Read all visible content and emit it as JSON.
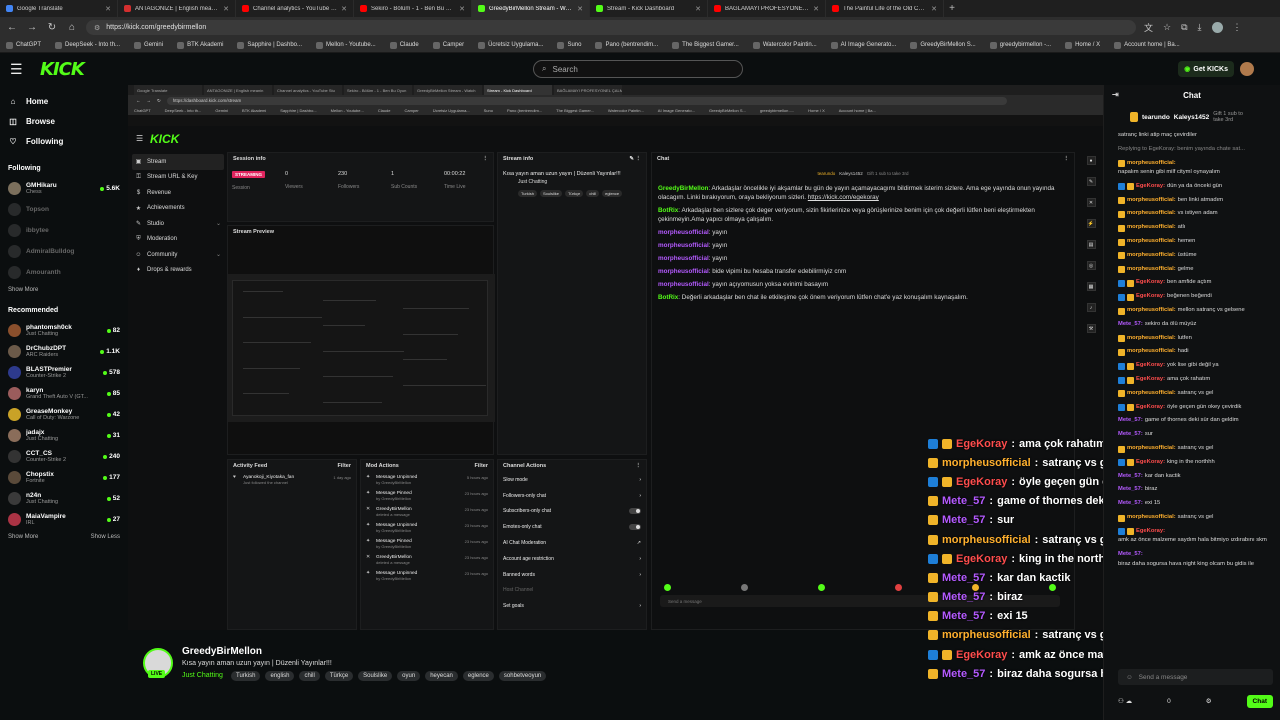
{
  "browser": {
    "tabs": [
      {
        "title": "Google Translate",
        "color": "#4285f4",
        "active": false
      },
      {
        "title": "ANTAGONIZE | English meaning -",
        "color": "#d32f2f",
        "active": false
      },
      {
        "title": "Channel analytics - YouTube Studi",
        "color": "#ff0000",
        "active": false
      },
      {
        "title": "Sekiro - Bölüm - 1 - Ben Bu Oyunu",
        "color": "#ff0000",
        "active": false
      },
      {
        "title": "GreedyBirMellon Stream - Watch",
        "color": "#53fc18",
        "active": true
      },
      {
        "title": "Stream - Kick Dashboard",
        "color": "#53fc18",
        "active": false
      },
      {
        "title": "BAĞLAMAYI PROFESYONEL ÇALM",
        "color": "#ff0000",
        "active": false
      },
      {
        "title": "The Painful Life of the Old Couple",
        "color": "#ff0000",
        "active": false
      }
    ],
    "new_tab": "+",
    "url": "https://kick.com/greedybirmellon",
    "bookmarks": [
      "ChatGPT",
      "DeepSeek - Into th...",
      "Gemini",
      "BTK Akademi",
      "Sapphire | Dashbo...",
      "Mellon - Youtube...",
      "Claude",
      "Camper",
      "Ücretsiz Uygulama...",
      "Suno",
      "Pano (bentrendim...",
      "The Biggest Gamer...",
      "Watercolor Paintin...",
      "AI Image Generato...",
      "GreedyBirMellon S...",
      "greedybirmellon -...",
      "Home / X",
      "Account home | Ba..."
    ]
  },
  "header": {
    "logo": "KICK",
    "search_placeholder": "Search",
    "get_kicks": "Get KICKs"
  },
  "sidebar": {
    "nav": [
      {
        "label": "Home",
        "icon": "⌂"
      },
      {
        "label": "Browse",
        "icon": "◫"
      },
      {
        "label": "Following",
        "icon": "♡"
      }
    ],
    "following_title": "Following",
    "following": [
      {
        "name": "GMHikaru",
        "category": "Chess",
        "viewers": "5.6K",
        "online": true,
        "color": "#7b6f5c"
      },
      {
        "name": "Topson",
        "category": "",
        "viewers": "",
        "online": false,
        "color": "#555"
      },
      {
        "name": "ibbytee",
        "category": "",
        "viewers": "",
        "online": false,
        "color": "#555"
      },
      {
        "name": "AdmiralBulldog",
        "category": "",
        "viewers": "",
        "online": false,
        "color": "#555"
      },
      {
        "name": "Amouranth",
        "category": "",
        "viewers": "",
        "online": false,
        "color": "#555"
      }
    ],
    "show_more_1": "Show More",
    "recommended_title": "Recommended",
    "recommended": [
      {
        "name": "phantomsh0ck",
        "category": "Just Chatting",
        "viewers": "82",
        "color": "#8a4f2c"
      },
      {
        "name": "DrChubzDPT",
        "category": "ARC Raiders",
        "viewers": "1.1K",
        "color": "#6b5a49"
      },
      {
        "name": "BLASTPremier",
        "category": "Counter-Strike 2",
        "viewers": "578",
        "color": "#2d3a8c"
      },
      {
        "name": "karyn",
        "category": "Grand Theft Auto V (GT...",
        "viewers": "85",
        "color": "#9b5c5c"
      },
      {
        "name": "GreaseMonkey",
        "category": "Call of Duty: Warzone",
        "viewers": "42",
        "color": "#c9a227"
      },
      {
        "name": "jadajx",
        "category": "Just Chatting",
        "viewers": "31",
        "color": "#8a6d5a"
      },
      {
        "name": "CCT_CS",
        "category": "Counter-Strike 2",
        "viewers": "240",
        "color": "#333"
      },
      {
        "name": "Chopstix",
        "category": "Fortnite",
        "viewers": "177",
        "color": "#5a4a3a"
      },
      {
        "name": "n24n",
        "category": "Just Chatting",
        "viewers": "52",
        "color": "#3a3a3a"
      },
      {
        "name": "MaiaVampire",
        "category": "IRL",
        "viewers": "27",
        "color": "#aa3344"
      }
    ],
    "show_more_2": "Show More",
    "show_less": "Show Less"
  },
  "video": {
    "inner_tabs": [
      "Google Translate",
      "ANTAGONIZE | English meanin",
      "Channel analytics - YouTube Stu",
      "Sekiro - Bölüm - 1 - Ben Bu Oyun",
      "GreedyBirMellon Stream - Watch",
      "Stream - Kick Dashboard",
      "BAĞLAMAYI PROFESYONEL ÇALM"
    ],
    "inner_url": "https://dashboard.kick.com/stream",
    "inner_bookmarks": [
      "ChatGPT",
      "DeepSeek - Into th...",
      "Gemini",
      "BTK Akademi",
      "Sapphire | Dashbo...",
      "Mellon - Youtube...",
      "Claude",
      "Camper",
      "Ücretsiz Uygulama...",
      "Suno",
      "Pano (bentrendim...",
      "The Biggest Gamer...",
      "Watercolor Paintin...",
      "AI Image Generato...",
      "GreedyBirMellon S...",
      "greedybirmellon -...",
      "Home / X",
      "Account home | Ba..."
    ],
    "dash_logo": "KICK",
    "dash_nav": [
      {
        "label": "Stream",
        "icon": "▣",
        "active": true,
        "chev": false
      },
      {
        "label": "Stream URL & Key",
        "icon": "⚿",
        "active": false,
        "chev": false
      },
      {
        "label": "Revenue",
        "icon": "$",
        "active": false,
        "chev": false
      },
      {
        "label": "Achievements",
        "icon": "★",
        "active": false,
        "chev": false
      },
      {
        "label": "Studio",
        "icon": "✎",
        "active": false,
        "chev": true
      },
      {
        "label": "Moderation",
        "icon": "⛨",
        "active": false,
        "chev": false
      },
      {
        "label": "Community",
        "icon": "☺",
        "active": false,
        "chev": true
      },
      {
        "label": "Drops & rewards",
        "icon": "♦",
        "active": false,
        "chev": false
      }
    ],
    "session": {
      "title": "Session info",
      "stats": [
        {
          "value": "STREAMING",
          "label": "Session",
          "badge": true
        },
        {
          "value": "0",
          "label": "Viewers",
          "badge": false
        },
        {
          "value": "230",
          "label": "Followers",
          "badge": false
        },
        {
          "value": "1",
          "label": "Sub Counts",
          "badge": false
        },
        {
          "value": "00:00:22",
          "label": "Time Live",
          "badge": false
        }
      ]
    },
    "preview_title": "Stream Preview",
    "info": {
      "title": "Stream info",
      "stream_title": "Kısa yayın aman uzun yayın | Düzenli Yayınlar!!!",
      "category": "Just Chatting",
      "tags": [
        "Turkish",
        "Soulslike",
        "Türkçe",
        "chill",
        "eglence"
      ]
    },
    "chat": {
      "title": "Chat",
      "pinned_user": "tearundo",
      "pinned_gift_user": "Kaleys1452",
      "pinned_gift_text": "Gift 1 sub to take 3rd",
      "messages": [
        {
          "user": "GreedyBirMellon",
          "color": "#53fc18",
          "text": "Arkadaşlar öncelikle iyi akşamlar bu gün de yayın açamayacagımı bildirmek isterim sizlere. Ama ege yayında onun yayında olacagım. Linki bırakıyorum, oraya bekliyorum sizleri.",
          "link": "https://kick.com/egekoray"
        },
        {
          "user": "BotRix",
          "color": "#53fc18",
          "text": "Arkadaşlar ben sizlere çok deger veriyorum, sizin fikirlerinize veya görüşlerinize benim için çok değerli lütfen beni eleştirmekten çekinmeyin.Ama yapıcı olmaya çalışalım.",
          "link": ""
        },
        {
          "user": "morpheusofficial",
          "color": "#b45aff",
          "text": "yayın",
          "link": ""
        },
        {
          "user": "morpheusofficial",
          "color": "#b45aff",
          "text": "yayın",
          "link": ""
        },
        {
          "user": "morpheusofficial",
          "color": "#b45aff",
          "text": "yayın",
          "link": ""
        },
        {
          "user": "morpheusofficial",
          "color": "#b45aff",
          "text": "bide vipimi bu hesaba transfer edebilirmiyiz cnm",
          "link": ""
        },
        {
          "user": "morpheusofficial",
          "color": "#b45aff",
          "text": "yayın açıyomusun yoksa evinimi basayım",
          "link": ""
        },
        {
          "user": "BotRix",
          "color": "#53fc18",
          "text": "Değerli arkadaşlar ben chat ile etkileşime çok önem veriyorum lütfen chat'e yaz konuşalım kaynaşalım.",
          "link": ""
        }
      ],
      "input_placeholder": "Send a message",
      "chat_btn": "Chat"
    },
    "activity": {
      "title": "Activity Feed",
      "filter": "Filter",
      "items": [
        {
          "user": "Ayanokoji_Kiyotaka_fan",
          "text": "Just followed the channel",
          "time": "1 day ago"
        }
      ]
    },
    "mod_actions": {
      "title": "Mod Actions",
      "filter": "Filter",
      "items": [
        {
          "action": "Message Unpinned",
          "by": "by GreedyBirMellon",
          "time": "5 hours ago",
          "icon": "✦"
        },
        {
          "action": "Message Pinned",
          "by": "by GreedyBirMellon",
          "time": "23 hours ago",
          "icon": "✦"
        },
        {
          "action": "GreedyBirMellon",
          "by": "deleted a message",
          "time": "23 hours ago",
          "icon": "✕"
        },
        {
          "action": "Message Unpinned",
          "by": "by GreedyBirMellon",
          "time": "23 hours ago",
          "icon": "✦"
        },
        {
          "action": "Message Pinned",
          "by": "by GreedyBirMellon",
          "time": "23 hours ago",
          "icon": "✦"
        },
        {
          "action": "GreedyBirMellon",
          "by": "deleted a message",
          "time": "23 hours ago",
          "icon": "✕"
        },
        {
          "action": "Message Unpinned",
          "by": "by GreedyBirMellon",
          "time": "23 hours ago",
          "icon": "✦"
        }
      ]
    },
    "chat_actions": {
      "title": "Channel Actions",
      "items": [
        {
          "label": "Slow mode",
          "control": "chevron"
        },
        {
          "label": "Followers-only chat",
          "control": "chevron"
        },
        {
          "label": "Subscribers-only chat",
          "control": "toggle"
        },
        {
          "label": "Emotes-only chat",
          "control": "toggle"
        },
        {
          "label": "AI Chat Moderation",
          "control": "ext"
        },
        {
          "label": "Account age restriction",
          "control": "chevron"
        },
        {
          "label": "Banned words",
          "control": "chevron"
        },
        {
          "label": "Host Channel",
          "control": "none"
        },
        {
          "label": "Set goals",
          "control": "chevron"
        }
      ]
    }
  },
  "overlay_chat": [
    {
      "user": "EgeKoray",
      "color": "#ff4d4d",
      "text": "ama çok rahatım",
      "badges": [
        "#1e7fd8",
        "#f0b429"
      ]
    },
    {
      "user": "morpheusofficial",
      "color": "#ffb02e",
      "text": "satranç vs gel",
      "badges": [
        "#f0b429"
      ]
    },
    {
      "user": "EgeKoray",
      "color": "#ff4d4d",
      "text": "öyle geçen gün okey çevirdik",
      "badges": [
        "#1e7fd8",
        "#f0b429"
      ]
    },
    {
      "user": "Mete_57",
      "color": "#b45aff",
      "text": "game of thornes deki sür dan geldim",
      "badges": [
        "#f0b429"
      ]
    },
    {
      "user": "Mete_57",
      "color": "#b45aff",
      "text": "sur",
      "badges": [
        "#f0b429"
      ]
    },
    {
      "user": "morpheusofficial",
      "color": "#ffb02e",
      "text": "satranç vs gel",
      "badges": [
        "#f0b429"
      ]
    },
    {
      "user": "EgeKoray",
      "color": "#ff4d4d",
      "text": "king in the northhh",
      "badges": [
        "#1e7fd8",
        "#f0b429"
      ]
    },
    {
      "user": "Mete_57",
      "color": "#b45aff",
      "text": "kar dan kactik",
      "badges": [
        "#f0b429"
      ]
    },
    {
      "user": "Mete_57",
      "color": "#b45aff",
      "text": "biraz",
      "badges": [
        "#f0b429"
      ]
    },
    {
      "user": "Mete_57",
      "color": "#b45aff",
      "text": "exi 15",
      "badges": [
        "#f0b429"
      ]
    },
    {
      "user": "morpheusofficial",
      "color": "#ffb02e",
      "text": "satranç vs gel",
      "badges": [
        "#f0b429"
      ]
    },
    {
      "user": "EgeKoray",
      "color": "#ff4d4d",
      "text": "amk az önce malzeme saydım hala bitmiyo ızdırabını skm",
      "badges": [
        "#1e7fd8",
        "#f0b429"
      ]
    },
    {
      "user": "Mete_57",
      "color": "#b45aff",
      "text": "biraz daha sogursa hava night king olcam bu gidis ile",
      "badges": [
        "#f0b429"
      ]
    }
  ],
  "stream": {
    "streamer": "GreedyBirMellon",
    "title": "Kısa yayın aman uzun yayın | Düzenli Yayınlar!!!",
    "category": "Just Chatting",
    "tags": [
      "Turkish",
      "english",
      "chill",
      "Türkçe",
      "Soulslike",
      "oyun",
      "heyecan",
      "eglence",
      "sohbetveoyun"
    ],
    "live_label": "LIVE"
  },
  "chat_panel": {
    "title": "Chat",
    "pinned_user": "tearundo",
    "pinned_user2": "Kaleys1452",
    "pinned_note": "Gift 1 sub to take 3rd",
    "messages": [
      {
        "user": "",
        "color": "#ddd",
        "text": "satranç linki atip maç çevirdiler",
        "badges": []
      },
      {
        "user": "",
        "color": "#888",
        "text": "Replying to EgeKoray: benim yayında chate sat...",
        "badges": []
      },
      {
        "user": "morpheusofficial",
        "color": "#ffb02e",
        "text": "napalım senin gibi milf cityml oynayalım",
        "badges": [
          "#f0b429"
        ]
      },
      {
        "user": "EgeKoray",
        "color": "#ff4d4d",
        "text": "dün ya da önceki gün",
        "badges": [
          "#1e7fd8",
          "#f0b429"
        ]
      },
      {
        "user": "morpheusofficial",
        "color": "#ffb02e",
        "text": "ben linki atmadım",
        "badges": [
          "#f0b429"
        ]
      },
      {
        "user": "morpheusofficial",
        "color": "#ffb02e",
        "text": "vs istiyen adam",
        "badges": [
          "#f0b429"
        ]
      },
      {
        "user": "morpheusofficial",
        "color": "#ffb02e",
        "text": "atlı",
        "badges": [
          "#f0b429"
        ]
      },
      {
        "user": "morpheusofficial",
        "color": "#ffb02e",
        "text": "hemen",
        "badges": [
          "#f0b429"
        ]
      },
      {
        "user": "morpheusofficial",
        "color": "#ffb02e",
        "text": "üstüme",
        "badges": [
          "#f0b429"
        ]
      },
      {
        "user": "morpheusofficial",
        "color": "#ffb02e",
        "text": "gelme",
        "badges": [
          "#f0b429"
        ]
      },
      {
        "user": "EgeKoray",
        "color": "#ff4d4d",
        "text": "ben amfide açtım",
        "badges": [
          "#1e7fd8",
          "#f0b429"
        ]
      },
      {
        "user": "EgeKoray",
        "color": "#ff4d4d",
        "text": "beğenen beğendi",
        "badges": [
          "#1e7fd8",
          "#f0b429"
        ]
      },
      {
        "user": "morpheusofficial",
        "color": "#ffb02e",
        "text": "mellon satranç vs gelsene",
        "badges": [
          "#f0b429"
        ]
      },
      {
        "user": "Mete_57",
        "color": "#b45aff",
        "text": "sekiro da ölü müyüz",
        "badges": []
      },
      {
        "user": "morpheusofficial",
        "color": "#ffb02e",
        "text": "lutfen",
        "badges": [
          "#f0b429"
        ]
      },
      {
        "user": "morpheusofficial",
        "color": "#ffb02e",
        "text": "hadi",
        "badges": [
          "#f0b429"
        ]
      },
      {
        "user": "EgeKoray",
        "color": "#ff4d4d",
        "text": "yok lise gibi değil ya",
        "badges": [
          "#1e7fd8",
          "#f0b429"
        ]
      },
      {
        "user": "EgeKoray",
        "color": "#ff4d4d",
        "text": "ama çok rahatım",
        "badges": [
          "#1e7fd8",
          "#f0b429"
        ]
      },
      {
        "user": "morpheusofficial",
        "color": "#ffb02e",
        "text": "satranç vs gel",
        "badges": [
          "#f0b429"
        ]
      },
      {
        "user": "EgeKoray",
        "color": "#ff4d4d",
        "text": "öyle geçen gün okey çevirdik",
        "badges": [
          "#1e7fd8",
          "#f0b429"
        ]
      },
      {
        "user": "Mete_57",
        "color": "#b45aff",
        "text": "game of thornes deki sür dan geldim",
        "badges": []
      },
      {
        "user": "Mete_57",
        "color": "#b45aff",
        "text": "sur",
        "badges": []
      },
      {
        "user": "morpheusofficial",
        "color": "#ffb02e",
        "text": "satranç vs gel",
        "badges": [
          "#f0b429"
        ]
      },
      {
        "user": "EgeKoray",
        "color": "#ff4d4d",
        "text": "king in the northhh",
        "badges": [
          "#1e7fd8",
          "#f0b429"
        ]
      },
      {
        "user": "Mete_57",
        "color": "#b45aff",
        "text": "kar dan kactik",
        "badges": []
      },
      {
        "user": "Mete_57",
        "color": "#b45aff",
        "text": "biraz",
        "badges": []
      },
      {
        "user": "Mete_57",
        "color": "#b45aff",
        "text": "exi 15",
        "badges": []
      },
      {
        "user": "morpheusofficial",
        "color": "#ffb02e",
        "text": "satranç vs gel",
        "badges": [
          "#f0b429"
        ]
      },
      {
        "user": "EgeKoray",
        "color": "#ff4d4d",
        "text": "amk az önce malzeme saydım hala bitmiyo ızdırabını skm",
        "badges": [
          "#1e7fd8",
          "#f0b429"
        ]
      },
      {
        "user": "Mete_57",
        "color": "#b45aff",
        "text": "biraz daha sogursa hava night king olcam bu gidis ile",
        "badges": []
      }
    ],
    "input_placeholder": "Send a message",
    "bottom_count": "0",
    "send_label": "Chat",
    "viewers_label": "0 Viewers"
  },
  "colors": {
    "kick_green": "#53fc18"
  }
}
